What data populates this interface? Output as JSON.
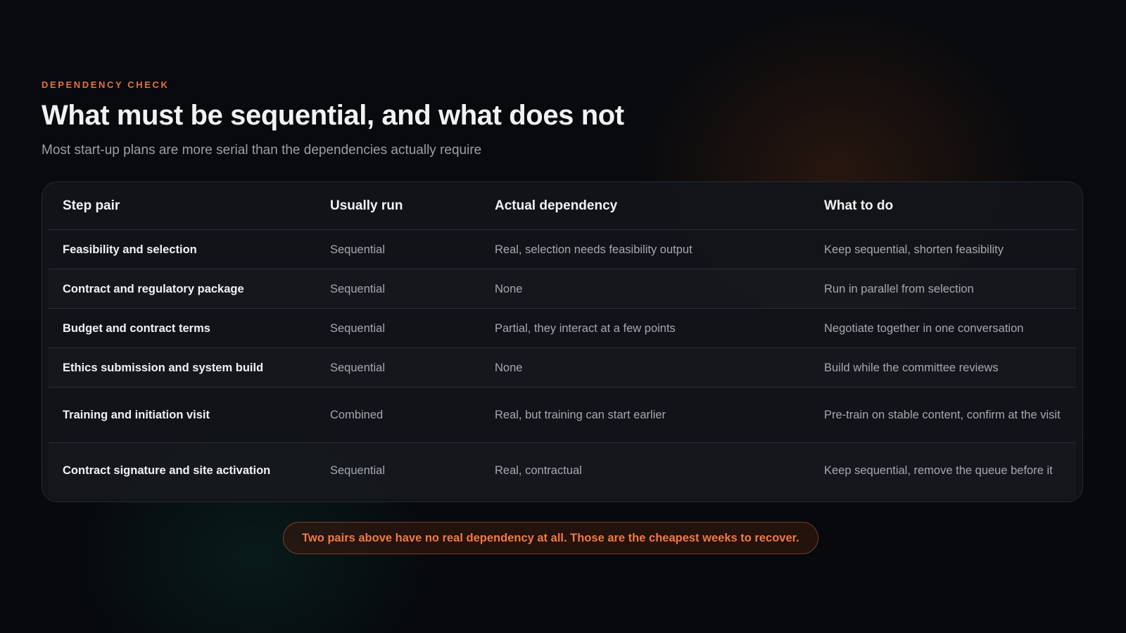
{
  "header": {
    "eyebrow": "DEPENDENCY CHECK",
    "title": "What must be sequential, and what does not",
    "subtitle": "Most start-up plans are more serial than the dependencies actually require"
  },
  "table": {
    "columns": [
      "Step pair",
      "Usually run",
      "Actual dependency",
      "What to do"
    ],
    "rows": [
      [
        "Feasibility and selection",
        "Sequential",
        "Real, selection needs feasibility output",
        "Keep sequential, shorten feasibility"
      ],
      [
        "Contract and regulatory package",
        "Sequential",
        "None",
        "Run in parallel from selection"
      ],
      [
        "Budget and contract terms",
        "Sequential",
        "Partial, they interact at a few points",
        "Negotiate together in one conversation"
      ],
      [
        "Ethics submission and system build",
        "Sequential",
        "None",
        "Build while the committee reviews"
      ],
      [
        "Training and initiation visit",
        "Combined",
        "Real, but training can start earlier",
        "Pre-train on stable content, confirm at the visit"
      ],
      [
        "Contract signature and site activation",
        "Sequential",
        "Real, contractual",
        "Keep sequential, remove the queue before it"
      ]
    ]
  },
  "callout": {
    "text": "Two pairs above have no real dependency at all. Those are the cheapest weeks to recover."
  },
  "colors": {
    "accent": "#e8703f",
    "background": "#07090c",
    "card": "#121519"
  }
}
